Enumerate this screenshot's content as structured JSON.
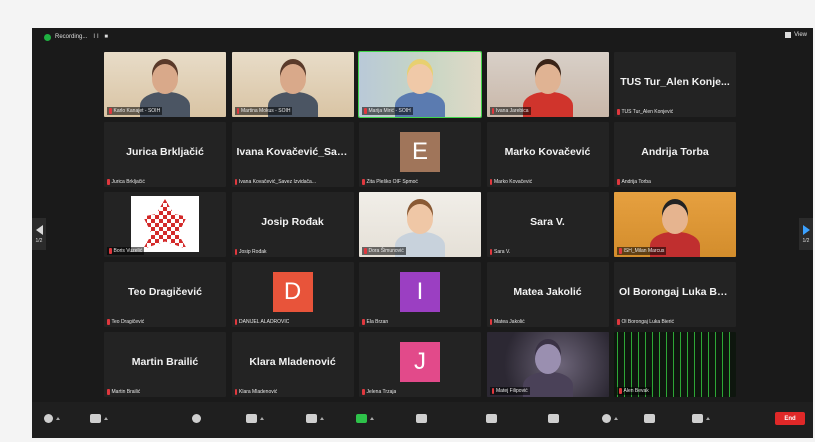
{
  "meeting": {
    "recording_label": "Recording...",
    "recording_controls": "II ■",
    "view_label": "View"
  },
  "pager": {
    "left_page": "1/2",
    "right_page": "1/2"
  },
  "tiles": [
    {
      "display_name": "",
      "caption": "Karlo Kanajet - SOIH",
      "video": "v-warm",
      "muted": true
    },
    {
      "display_name": "",
      "caption": "Martina Mokus - SOIH",
      "video": "v-warm",
      "muted": true
    },
    {
      "display_name": "",
      "caption": "Marija Mirić - SOIH",
      "video": "v-office",
      "muted": true,
      "speaking": true
    },
    {
      "display_name": "",
      "caption": "Ivana Jarebica",
      "video": "v-red",
      "muted": true
    },
    {
      "display_name": "TUS Tur_Alen Konje...",
      "caption": "TUS Tur_Alen Konjević",
      "muted": true
    },
    {
      "display_name": "Jurica Brkljačić",
      "caption": "Jurica Brkljačić",
      "muted": true
    },
    {
      "display_name": "Ivana Kovačević_Sav...",
      "caption": "Ivana Kovačević_Savez Izvidača...",
      "muted": true
    },
    {
      "display_name": "",
      "caption": "Zita Pleško OIF Spmoć",
      "muted": true,
      "letter": "E",
      "letter_color": "#a0755a"
    },
    {
      "display_name": "Marko Kovačević",
      "caption": "Marko Kovačević",
      "muted": true
    },
    {
      "display_name": "Andrija Torba",
      "caption": "Andrija Torba",
      "muted": true
    },
    {
      "display_name": "",
      "caption": "Boris Vuzelić",
      "muted": true,
      "logo": true
    },
    {
      "display_name": "Josip Rođak",
      "caption": "Josip Rođak",
      "muted": true
    },
    {
      "display_name": "",
      "caption": "Dora Šimunović",
      "video": "v-white",
      "muted": true
    },
    {
      "display_name": "Sara V.",
      "caption": "Sara V.",
      "muted": true
    },
    {
      "display_name": "",
      "caption": "ISH_Milan Marcus",
      "video": "v-orange",
      "muted": true
    },
    {
      "display_name": "Teo Dragičević",
      "caption": "Teo Dragičević",
      "muted": true
    },
    {
      "display_name": "",
      "caption": "DANIJEL ALADROVIĆ",
      "muted": true,
      "letter": "D",
      "letter_color": "#e8543a"
    },
    {
      "display_name": "",
      "caption": "Ela Brzan",
      "muted": true,
      "letter": "I",
      "letter_color": "#9b3fc2"
    },
    {
      "display_name": "Matea Jakolić",
      "caption": "Matea Jakolić",
      "muted": true
    },
    {
      "display_name": "Ol Borongaj Luka Bo...",
      "caption": "Ol Borongaj Luka Bierić",
      "muted": true
    },
    {
      "display_name": "Martin Brailić",
      "caption": "Martin Brailić",
      "muted": true
    },
    {
      "display_name": "Klara Mladenović",
      "caption": "Klara Mladenović",
      "muted": true
    },
    {
      "display_name": "",
      "caption": "Jelena Trzaja",
      "muted": true,
      "letter": "J",
      "letter_color": "#e24a8a"
    },
    {
      "display_name": "",
      "caption": "Matej Filipović",
      "video": "v-dark",
      "muted": true
    },
    {
      "display_name": "",
      "caption": "Alen Bevak",
      "video": "v-matrix",
      "muted": true
    }
  ],
  "toolbar": {
    "end_label": "End",
    "items": [
      "mute-icon",
      "video-icon",
      "security-icon",
      "participants-icon",
      "chat-icon",
      "share-screen-icon",
      "record-icon",
      "reactions-icon",
      "breakout-icon",
      "apps-icon",
      "whiteboard-icon",
      "more-icon"
    ]
  },
  "colors": {
    "window_bg": "#1a1a1a",
    "tile_bg": "#232323",
    "speaking": "#3fd44a",
    "end": "#e02828",
    "mute": "#e0383e"
  }
}
